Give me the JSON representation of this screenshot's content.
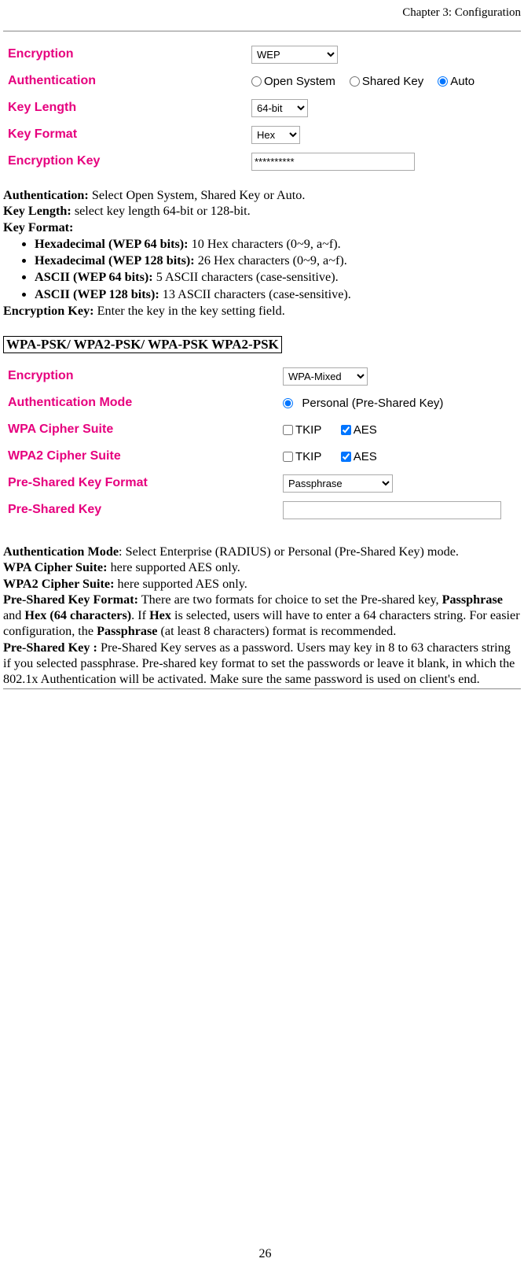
{
  "header": {
    "chapter": "Chapter 3: Configuration"
  },
  "wep_form": {
    "encryption_label": "Encryption",
    "encryption_value": "WEP",
    "auth_label": "Authentication",
    "auth_open": "Open System",
    "auth_shared": "Shared Key",
    "auth_auto": "Auto",
    "key_length_label": "Key Length",
    "key_length_value": "64-bit",
    "key_format_label": "Key Format",
    "key_format_value": "Hex",
    "enc_key_label": "Encryption Key",
    "enc_key_value": "**********"
  },
  "wep_desc": {
    "auth_bold": "Authentication:",
    "auth_text": " Select Open System, Shared Key or Auto.",
    "keylen_bold": "Key Length:",
    "keylen_text": " select key length 64-bit or 128-bit.",
    "keyfmt_bold": "Key Format:",
    "bullets": {
      "b1_bold": "Hexadecimal (WEP 64 bits):",
      "b1_text": " 10 Hex characters (0~9, a~f).",
      "b2_bold": "Hexadecimal (WEP 128 bits):",
      "b2_text": " 26 Hex characters (0~9, a~f).",
      "b3_bold": "ASCII (WEP 64 bits):",
      "b3_text": " 5 ASCII characters (case-sensitive).",
      "b4_bold": "ASCII (WEP 128 bits):",
      "b4_text": " 13 ASCII characters (case-sensitive)."
    },
    "enckey_bold": "Encryption Key:",
    "enckey_text": " Enter the key in the key setting field."
  },
  "wpa_heading": "WPA-PSK/ WPA2-PSK/ WPA-PSK WPA2-PSK",
  "wpa_form": {
    "encryption_label": "Encryption",
    "encryption_value": "WPA-Mixed",
    "authmode_label": "Authentication Mode",
    "authmode_value": "Personal (Pre-Shared Key)",
    "wpa_suite_label": "WPA Cipher Suite",
    "wpa2_suite_label": "WPA2 Cipher Suite",
    "tkip_label": "TKIP",
    "aes_label": "AES",
    "psk_format_label": "Pre-Shared Key Format",
    "psk_format_value": "Passphrase",
    "psk_label": "Pre-Shared Key"
  },
  "wpa_desc": {
    "authmode_bold": "Authentication Mode",
    "authmode_text": ": Select Enterprise (RADIUS) or Personal (Pre-Shared Key) mode.",
    "wpa_suite_bold": "WPA Cipher Suite:",
    "wpa_suite_text": " here supported AES only.",
    "wpa2_suite_bold": "WPA2 Cipher Suite:",
    "wpa2_suite_text": " here supported AES only.",
    "pskfmt_bold": "Pre-Shared Key Format:",
    "pskfmt_text1": "  There are two formats for choice to set the Pre-shared key, ",
    "pskfmt_pass": "Passphrase",
    "pskfmt_and": " and ",
    "pskfmt_hex": "Hex (64 characters)",
    "pskfmt_text2": ". If ",
    "pskfmt_hex2": "Hex",
    "pskfmt_text3": " is selected, users will have to enter a 64 characters string. For easier configuration, the ",
    "pskfmt_pass2": "Passphrase",
    "pskfmt_text4": " (at least 8 characters) format is recommended.",
    "psk_bold": "Pre-Shared Key :",
    "psk_text": " Pre-Shared Key serves as a password.  Users may key in 8 to 63 characters string if you selected passphrase. Pre-shared key format to set the passwords or leave it blank, in which the 802.1x Authentication will be activated.  Make sure the same password is used on client's end."
  },
  "page_number": "26"
}
